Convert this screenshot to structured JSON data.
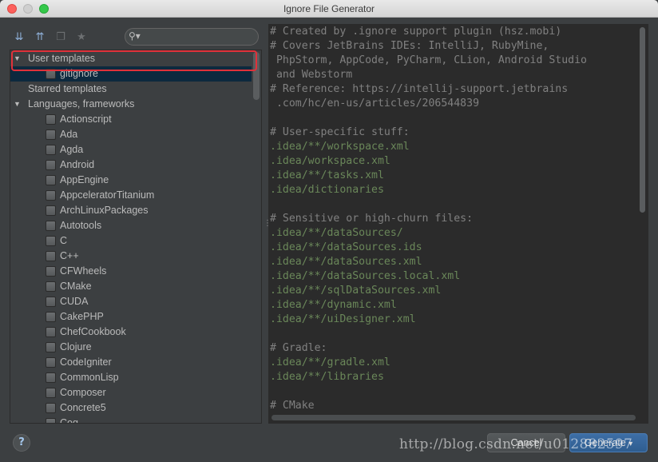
{
  "window": {
    "title": "Ignore File Generator"
  },
  "toolbar": {
    "expand_icon": "expand-all-icon",
    "collapse_icon": "collapse-all-icon",
    "copy_icon": "copy-icon",
    "star_icon": "star-icon",
    "search_placeholder": "",
    "search_value": ""
  },
  "tree": {
    "groups": [
      {
        "label": "User templates",
        "expanded": true,
        "items": [
          "gitignore"
        ]
      },
      {
        "label": "Starred templates",
        "expanded": false,
        "items": []
      },
      {
        "label": "Languages, frameworks",
        "expanded": true,
        "items": [
          "Actionscript",
          "Ada",
          "Agda",
          "Android",
          "AppEngine",
          "AppceleratorTitanium",
          "ArchLinuxPackages",
          "Autotools",
          "C",
          "C++",
          "CFWheels",
          "CMake",
          "CUDA",
          "CakePHP",
          "ChefCookbook",
          "Clojure",
          "CodeIgniter",
          "CommonLisp",
          "Composer",
          "Concrete5",
          "Coq"
        ]
      }
    ]
  },
  "editor": {
    "lines": [
      {
        "text": "# Created by .ignore support plugin (hsz.mobi)",
        "kind": "comment"
      },
      {
        "text": "# Covers JetBrains IDEs: IntelliJ, RubyMine,",
        "kind": "comment"
      },
      {
        "text": " PhpStorm, AppCode, PyCharm, CLion, Android Studio",
        "kind": "comment"
      },
      {
        "text": " and Webstorm",
        "kind": "comment"
      },
      {
        "text": "# Reference: https://intellij-support.jetbrains",
        "kind": "comment"
      },
      {
        "text": " .com/hc/en-us/articles/206544839",
        "kind": "comment"
      },
      {
        "text": "",
        "kind": "comment"
      },
      {
        "text": "# User-specific stuff:",
        "kind": "comment"
      },
      {
        "text": ".idea/**/workspace.xml",
        "kind": "path"
      },
      {
        "text": ".idea/workspace.xml",
        "kind": "path"
      },
      {
        "text": ".idea/**/tasks.xml",
        "kind": "path"
      },
      {
        "text": ".idea/dictionaries",
        "kind": "path"
      },
      {
        "text": "",
        "kind": "comment"
      },
      {
        "text": "# Sensitive or high-churn files:",
        "kind": "comment"
      },
      {
        "text": ".idea/**/dataSources/",
        "kind": "path"
      },
      {
        "text": ".idea/**/dataSources.ids",
        "kind": "path"
      },
      {
        "text": ".idea/**/dataSources.xml",
        "kind": "path"
      },
      {
        "text": ".idea/**/dataSources.local.xml",
        "kind": "path"
      },
      {
        "text": ".idea/**/sqlDataSources.xml",
        "kind": "path"
      },
      {
        "text": ".idea/**/dynamic.xml",
        "kind": "path"
      },
      {
        "text": ".idea/**/uiDesigner.xml",
        "kind": "path"
      },
      {
        "text": "",
        "kind": "comment"
      },
      {
        "text": "# Gradle:",
        "kind": "comment"
      },
      {
        "text": ".idea/**/gradle.xml",
        "kind": "path"
      },
      {
        "text": ".idea/**/libraries",
        "kind": "path"
      },
      {
        "text": "",
        "kind": "comment"
      },
      {
        "text": "# CMake",
        "kind": "comment"
      }
    ]
  },
  "footer": {
    "help_label": "?",
    "cancel_label": "Cancel",
    "generate_label": "Generate",
    "generate_caret": "▾"
  },
  "watermark": "http://blog.csdn.net/u012882597",
  "colors": {
    "highlight": "#e0313a",
    "comment": "#808080",
    "path": "#6a8759",
    "selection": "#0d293e"
  }
}
